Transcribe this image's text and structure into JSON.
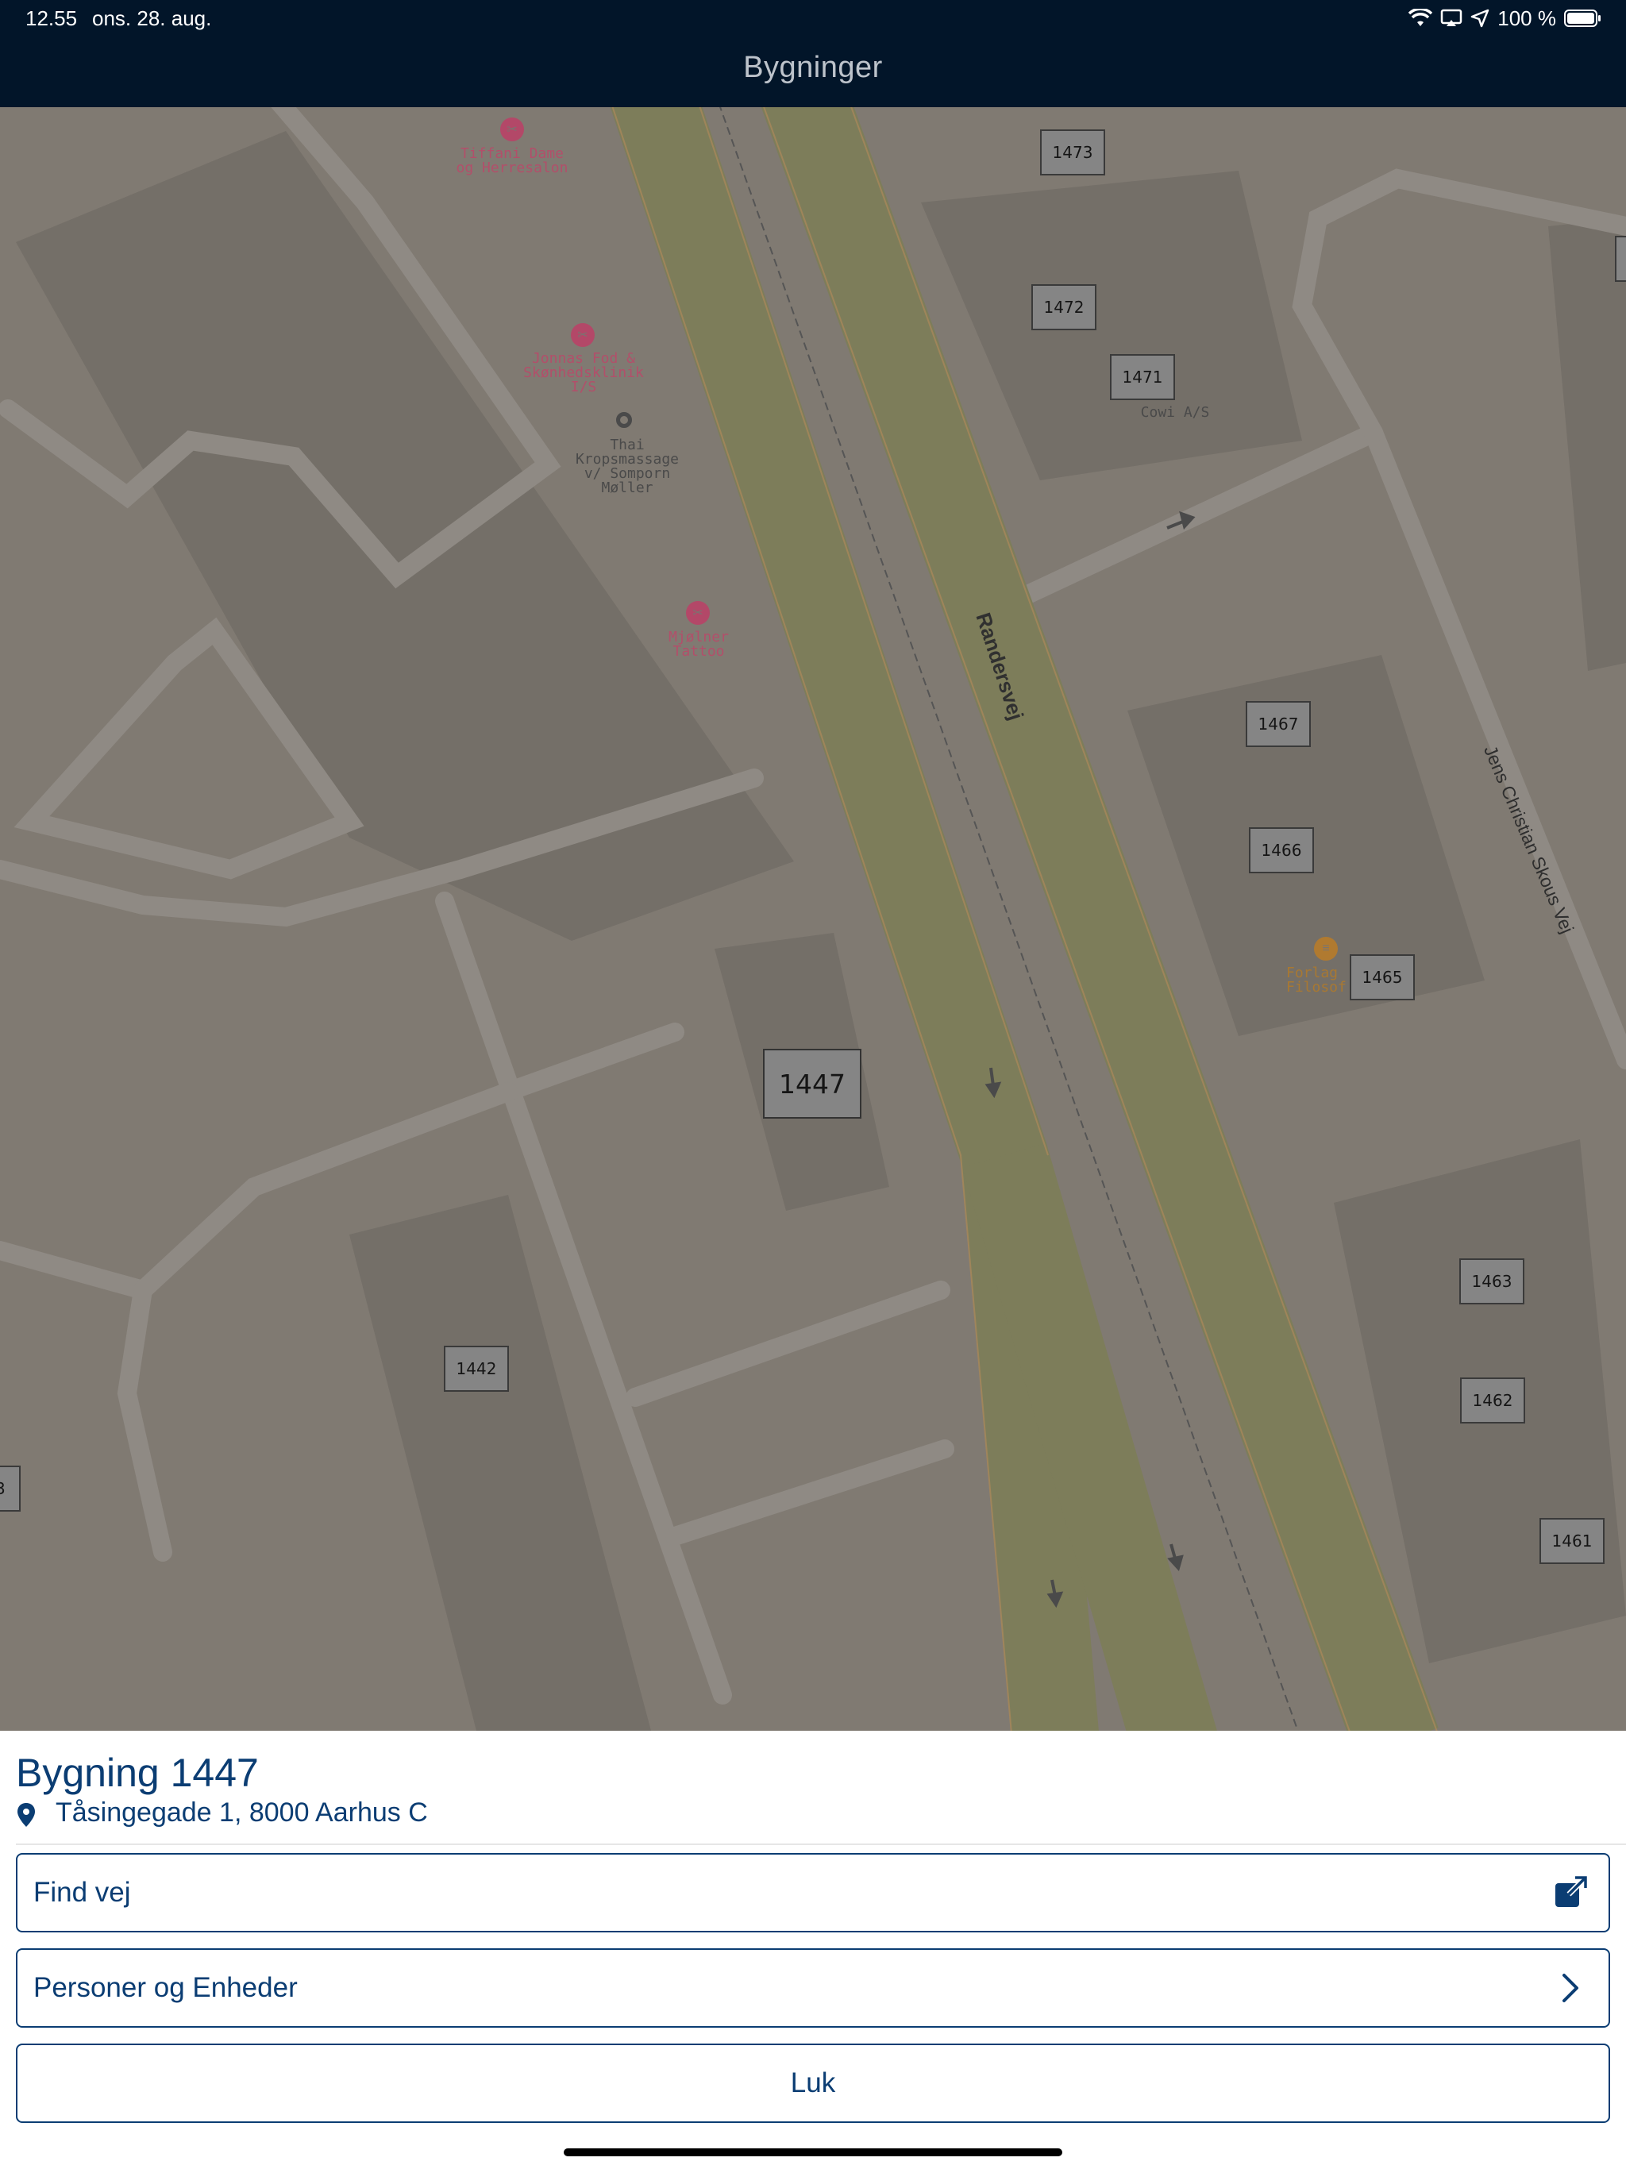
{
  "status_bar": {
    "time": "12.55",
    "date": "ons. 28. aug.",
    "battery": "100 %",
    "icons": [
      "wifi-icon",
      "screen-mirroring-icon",
      "location-arrow-icon",
      "battery-icon"
    ]
  },
  "nav": {
    "title": "Bygninger"
  },
  "map": {
    "roads": {
      "main": "Randersvej",
      "side": "Jens Christian Skous Vej"
    },
    "pois": [
      {
        "name": "Tiffani Dame og Herresalon",
        "lines": [
          "Tiffani Dame",
          "og Herresalon"
        ]
      },
      {
        "name": "Jonnas Fod & Skønhedsklinik I/S",
        "lines": [
          "Jonnas Fod &",
          "Skønhedsklinik",
          "I/S"
        ]
      },
      {
        "name": "Thai Kropsmassage v/ Somporn Møller",
        "lines": [
          "Thai",
          "Kropsmassage",
          "v/ Somporn",
          "Møller"
        ]
      },
      {
        "name": "Mjølner Tattoo",
        "lines": [
          "Mjølner",
          "Tattoo"
        ]
      },
      {
        "name": "Cowi A/S",
        "lines": [
          "Cowi A/S"
        ]
      },
      {
        "name": "Forlag Filosof",
        "lines": [
          "Forlag",
          "Filosof"
        ]
      }
    ],
    "buildings": [
      "1473",
      "1472",
      "1471",
      "1467",
      "1466",
      "1465",
      "1447",
      "1442",
      "1463",
      "1462",
      "1461",
      "3"
    ],
    "selected_building": "1447"
  },
  "sheet": {
    "title": "Bygning 1447",
    "address": "Tåsingegade 1, 8000 Aarhus C",
    "buttons": {
      "find_vej": "Find vej",
      "personer": "Personer og Enheder",
      "luk": "Luk"
    }
  },
  "colors": {
    "navy": "#0b3d73",
    "topbar": "#021529",
    "map_overlay": "#807a72"
  }
}
